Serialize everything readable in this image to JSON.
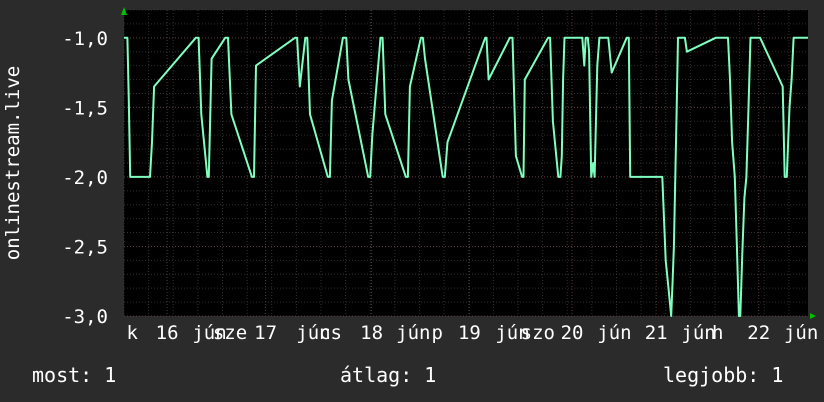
{
  "chart_data": {
    "type": "line",
    "ylabel": "onlinestream.live",
    "yticks": [
      -1.0,
      -1.5,
      -2.0,
      -2.5,
      -3.0
    ],
    "ytick_labels": [
      "-1,0",
      "-1,5",
      "-2,0",
      "-2,5",
      "-3,0"
    ],
    "ylim": [
      -3.0,
      -0.8
    ],
    "xlim": [
      0,
      100
    ],
    "xtick_labels": [
      "k",
      "16",
      "jún",
      "sze",
      "17",
      "jún",
      "cs",
      "18",
      "jún",
      "p",
      "19",
      "jún",
      "szo",
      "20",
      "jún",
      "21",
      "jún",
      "h",
      "22",
      "jún"
    ],
    "xtick_positions": [
      1.2,
      6.3,
      12.5,
      15.5,
      20.7,
      27.7,
      30.2,
      36.2,
      42.3,
      45.8,
      50.5,
      56.8,
      60.5,
      65.5,
      71.7,
      77.8,
      84.0,
      86.8,
      92.8,
      99.0
    ],
    "series": [
      {
        "color": "#7fffbf",
        "x": [
          0,
          0.5,
          0.7,
          0.9,
          3.8,
          4.1,
          4.4,
          10.5,
          10.9,
          11.3,
          12.2,
          12.4,
          12.8,
          14.8,
          15.2,
          15.7,
          18.7,
          19.0,
          19.3,
          25.0,
          25.3,
          25.7,
          26.5,
          26.8,
          27.2,
          29.8,
          30.1,
          30.4,
          32.0,
          32.5,
          32.8,
          35.7,
          36.0,
          36.3,
          37.5,
          37.8,
          38.2,
          41.2,
          41.5,
          41.8,
          43.4,
          43.7,
          44.0,
          46.6,
          46.9,
          47.3,
          52.8,
          53.0,
          53.3,
          56.4,
          56.8,
          57.3,
          58.2,
          58.4,
          58.6,
          62.0,
          62.3,
          62.7,
          63.5,
          63.8,
          64.0,
          64.2,
          64.4,
          64.6,
          64.8,
          67.0,
          67.3,
          67.5,
          67.8,
          68.0,
          68.3,
          68.6,
          68.8,
          69.2,
          69.5,
          69.8,
          70.5,
          70.8,
          71.3,
          73.5,
          73.8,
          74.0,
          76.2,
          76.6,
          77.0,
          77.4,
          77.8,
          78.2,
          78.7,
          79.2,
          79.6,
          80.0,
          80.2,
          80.4,
          80.6,
          80.8,
          81.0,
          81.2,
          82.0,
          82.3,
          86.5,
          87.0,
          87.5,
          88.3,
          88.6,
          88.9,
          89.3,
          89.6,
          89.9,
          90.1,
          90.4,
          90.7,
          91.0,
          91.3,
          91.6,
          91.9,
          92.2,
          92.4,
          92.7,
          93.0,
          96.3,
          96.6,
          96.9,
          97.3,
          97.6,
          97.9,
          98.2,
          98.5,
          98.7,
          99.0,
          100
        ],
        "y": [
          -1.0,
          -1.0,
          -1.45,
          -2.0,
          -2.0,
          -1.75,
          -1.35,
          -1.0,
          -1.0,
          -1.55,
          -2.0,
          -2.0,
          -1.15,
          -1.0,
          -1.0,
          -1.55,
          -2.0,
          -2.0,
          -1.2,
          -1.0,
          -1.0,
          -1.35,
          -1.0,
          -1.0,
          -1.55,
          -2.0,
          -2.0,
          -1.45,
          -1.0,
          -1.0,
          -1.3,
          -2.0,
          -2.0,
          -1.7,
          -1.0,
          -1.0,
          -1.55,
          -2.0,
          -2.0,
          -1.35,
          -1.0,
          -1.0,
          -1.15,
          -2.0,
          -2.0,
          -1.75,
          -1.0,
          -1.0,
          -1.3,
          -1.0,
          -1.0,
          -1.85,
          -2.0,
          -2.0,
          -1.3,
          -1.0,
          -1.0,
          -1.6,
          -2.0,
          -2.0,
          -1.85,
          -1.3,
          -1.0,
          -1.0,
          -1.0,
          -1.0,
          -1.2,
          -1.0,
          -1.0,
          -1.1,
          -2.0,
          -1.9,
          -2.0,
          -1.2,
          -1.0,
          -1.0,
          -1.0,
          -1.0,
          -1.25,
          -1.0,
          -1.0,
          -2.0,
          -2.0,
          -2.0,
          -2.0,
          -2.0,
          -2.0,
          -2.0,
          -2.0,
          -2.6,
          -2.8,
          -3.0,
          -2.75,
          -2.5,
          -2.0,
          -1.5,
          -1.0,
          -1.0,
          -1.0,
          -1.1,
          -1.0,
          -1.0,
          -1.0,
          -1.0,
          -1.3,
          -1.75,
          -2.0,
          -2.5,
          -3.0,
          -3.0,
          -2.55,
          -2.15,
          -2.0,
          -1.5,
          -1.0,
          -1.0,
          -1.0,
          -1.0,
          -1.0,
          -1.0,
          -1.35,
          -2.0,
          -2.0,
          -1.5,
          -1.3,
          -1.0,
          -1.0,
          -1.0,
          -1.0,
          -1.0,
          -1.0
        ]
      }
    ]
  },
  "footer": {
    "now": "most: 1",
    "avg": "átlag: 1",
    "best": "legjobb: 1"
  },
  "colors": {
    "background": "#2b2b2b",
    "plot_background": "#000000",
    "grid": "#444444",
    "line": "#7fffbf",
    "axis_arrow": "#00c000"
  }
}
